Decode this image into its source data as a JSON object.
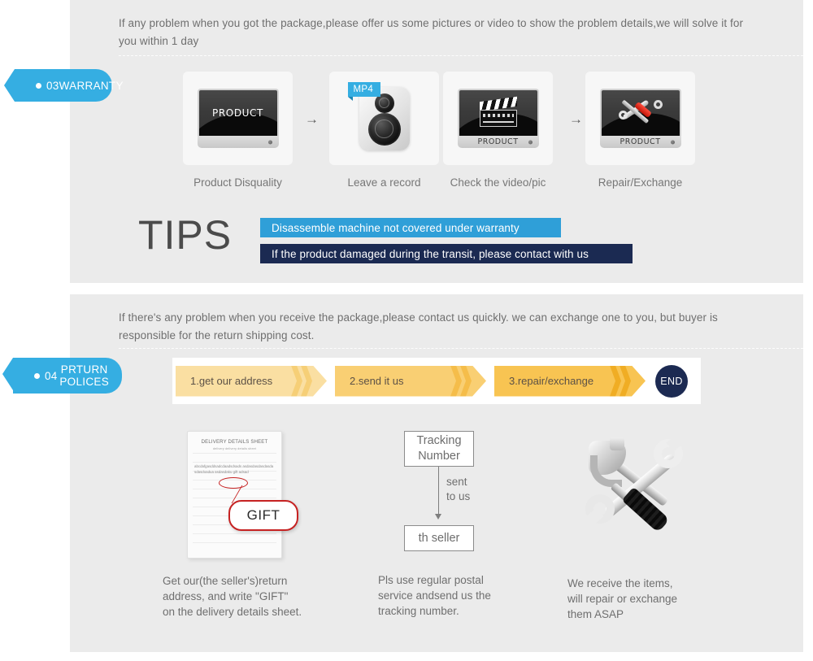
{
  "colors": {
    "panel_bg": "#ebebeb",
    "badge_blue": "#35aee2",
    "tip_light_blue": "#2f9fd8",
    "tip_navy": "#1b2a52",
    "arrow_yellow_1": "#fadfa2",
    "arrow_yellow_2": "#f9cf73",
    "arrow_yellow_3": "#f8c452",
    "end_navy": "#1c2a52",
    "gift_red": "#c62222"
  },
  "warranty": {
    "badge": {
      "number": "03",
      "label": "WARRANTY"
    },
    "intro": "If any problem when you got the package,please offer us some pictures or video to show the problem details,we will solve it for you within 1 day",
    "steps": [
      {
        "caption": "Product Disquality",
        "screen_label": "PRODUCT",
        "icon": "monitor-icon"
      },
      {
        "caption": "Leave a record",
        "tag": "MP4",
        "icon": "camera-icon"
      },
      {
        "caption": "Check the video/pic",
        "bezel_label": "PRODUCT",
        "icon": "clapperboard-icon"
      },
      {
        "caption": "Repair/Exchange",
        "bezel_label": "PRODUCT",
        "icon": "tools-icon"
      }
    ],
    "step_separator": "→",
    "tips": {
      "heading": "TIPS",
      "bars": [
        "Disassemble machine not covered under warranty",
        "If the product damaged during the transit, please contact with us"
      ]
    }
  },
  "returns": {
    "badge": {
      "number": "04",
      "label_line1": "PRTURN",
      "label_line2": "POLICES"
    },
    "intro": "If  there's any problem when you receive the package,please contact us quickly. we can exchange one to you, but buyer is responsible for the return shipping cost.",
    "flow": {
      "steps": [
        "1.get our address",
        "2.send it us",
        "3.repair/exchange"
      ],
      "end_label": "END"
    },
    "columns": [
      {
        "caption": "Get our(the seller's)return\naddress, and write \"GIFT\"\non the delivery details sheet.",
        "sheet": {
          "title": "DELIVERY DETAILS SHEET",
          "subtitle": "delivery          delivery details sheet",
          "body": "abcdafgasddsadcdaadsdsads asdasdasdasdasdasdasdoadua asdasdaku  gift  adsad",
          "callout": "GIFT"
        }
      },
      {
        "caption": "Pls use regular postal\nservice andsend us the\n tracking number.",
        "diagram": {
          "top_box": "Tracking\nNumber",
          "arrow_label": "sent\nto us",
          "bottom_box": "th seller"
        }
      },
      {
        "caption": "We receive the items,\nwill repair or exchange\n them ASAP",
        "icon": "hammer-wrench-icon"
      }
    ]
  }
}
